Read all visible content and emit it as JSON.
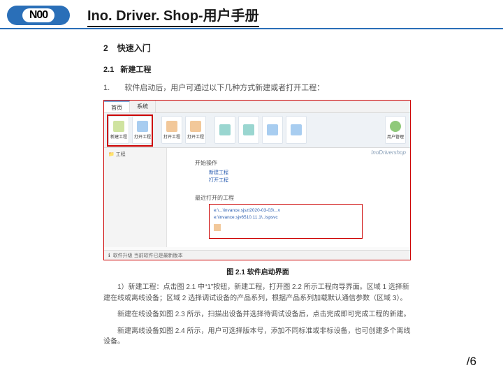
{
  "header": {
    "logo": "N00",
    "title": "Ino. Driver. Shop-用户手册"
  },
  "section": {
    "number": "2",
    "title": "快速入门",
    "sub_number": "2.1",
    "sub_title": "新建工程",
    "list_number": "1.",
    "intro": "软件启动后，用户可通过以下几种方式新建或者打开工程："
  },
  "screenshot": {
    "tabs": {
      "t1": "首页",
      "t2": "系统"
    },
    "ribbon": {
      "btn1": "新建工程",
      "btn2": "打开工程",
      "btn3": "打开工程",
      "btn4": "打开工程",
      "btn5": "",
      "btn6": "",
      "btn7": "",
      "btn8": "",
      "btn9": "用户管理"
    },
    "sidebar_label": "工程",
    "brand": "InoDrivershop",
    "panel_title_1": "开始操作",
    "link1": "新建工程",
    "link2": "打开工程",
    "panel_title_2": "最近打开的工程",
    "recent1": "e:\\...\\invance.sjszl2020-03-03\\...v",
    "recent2": "e:\\invance.sjv6510.11.1\\..\\spsvc",
    "status": "软件升级 当前软件已是最新版本"
  },
  "caption": "图 2.1 软件启动界面",
  "paragraphs": {
    "p1": "1）新建工程：点击图 2.1 中“1”按钮，新建工程，打开图 2.2 所示工程向导界面。区域 1 选择新建在线或离线设备；区域 2 选择调试设备的产品系列，根据产品系列加载默认通信参数（区域 3）。",
    "p2": "新建在线设备如图 2.3 所示，扫描出设备并选择待调试设备后，点击完成即可完成工程的新建。",
    "p3": "新建离线设备如图 2.4 所示，用户可选择版本号，添加不同标准或非标设备，也可创建多个离线设备。"
  },
  "footer": {
    "sep": "/",
    "page": "6"
  }
}
